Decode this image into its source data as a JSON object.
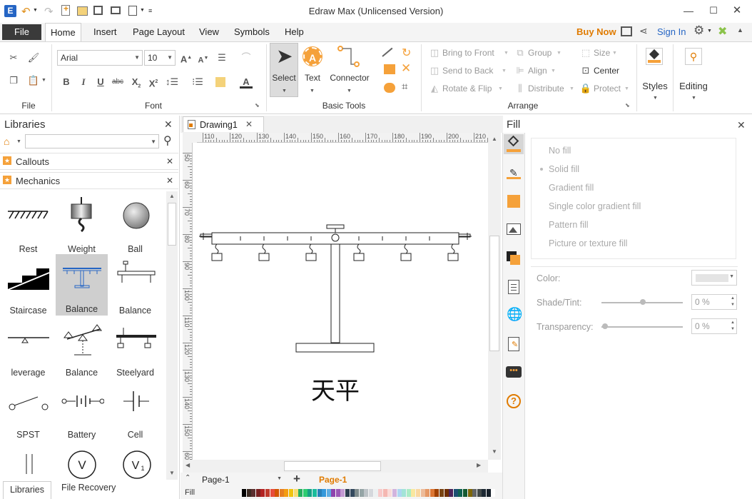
{
  "app": {
    "title": "Edraw Max (Unlicensed Version)",
    "buy_now": "Buy Now",
    "sign_in": "Sign In",
    "accent": "#e07b00"
  },
  "menu": {
    "file": "File",
    "tabs": [
      "Home",
      "Insert",
      "Page Layout",
      "View",
      "Symbols",
      "Help"
    ]
  },
  "ribbon": {
    "groups": {
      "file": "File",
      "font": "Font",
      "basic_tools": "Basic Tools",
      "arrange": "Arrange"
    },
    "font_name": "Arial",
    "font_size": "10",
    "tools": {
      "select": "Select",
      "text": "Text",
      "connector": "Connector"
    },
    "arrange": {
      "bring_to_front": "Bring to Front",
      "send_to_back": "Send to Back",
      "rotate_flip": "Rotate & Flip",
      "group": "Group",
      "align": "Align",
      "distribute": "Distribute",
      "size": "Size",
      "center": "Center",
      "protect": "Protect"
    },
    "styles": "Styles",
    "editing": "Editing"
  },
  "libraries": {
    "title": "Libraries",
    "sections": [
      "Callouts",
      "Mechanics"
    ],
    "shapes": [
      [
        "Rest",
        "Weight",
        "Ball"
      ],
      [
        "Staircase",
        "Balance",
        "Balance"
      ],
      [
        "leverage",
        "Balance",
        "Steelyard"
      ],
      [
        "SPST",
        "Battery",
        "Cell"
      ],
      [
        "",
        "",
        ""
      ]
    ],
    "bottom_tabs": [
      "Libraries",
      "File Recovery"
    ]
  },
  "document": {
    "tab": "Drawing1",
    "ruler_top": [
      "110",
      "120",
      "130",
      "140",
      "150",
      "160",
      "170",
      "180",
      "190",
      "200",
      "210"
    ],
    "ruler_left": [
      "50",
      "60",
      "70",
      "80",
      "90",
      "100",
      "110",
      "120",
      "130",
      "140",
      "150",
      "60"
    ],
    "canvas_caption": "天平",
    "page_tabs": [
      "Page-1",
      "Page-1"
    ],
    "fill_label": "Fill"
  },
  "fill_panel": {
    "title": "Fill",
    "options": [
      "No fill",
      "Solid fill",
      "Gradient fill",
      "Single color gradient fill",
      "Pattern fill",
      "Picture or texture fill"
    ],
    "color_label": "Color:",
    "shade_label": "Shade/Tint:",
    "transparency_label": "Transparency:",
    "shade_value": "0 %",
    "transparency_value": "0 %"
  },
  "icons": [
    "fill-icon",
    "line-icon",
    "shadow-icon",
    "image-icon",
    "layers-icon",
    "page-icon",
    "globe-icon",
    "attachment-icon",
    "comment-icon",
    "help-icon"
  ]
}
